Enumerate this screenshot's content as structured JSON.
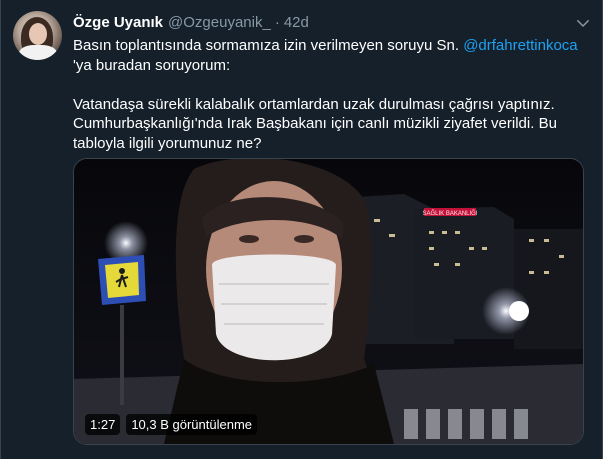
{
  "author": {
    "name": "Özge Uyanık",
    "handle": "@Ozgeuyanik_",
    "separator": "·",
    "time": "42d"
  },
  "tweet": {
    "line1_prefix": "Basın toplantısında sormamıza izin verilmeyen soruyu Sn.",
    "mention": "@drfahrettinkoca",
    "line1_suffix": "'ya buradan soruyorum:",
    "line2": "Vatandaşa sürekli kalabalık ortamlardan uzak durulması çağrısı yaptınız. Cumhurbaşkanlığı'nda Irak Başbakanı için canlı müzikli ziyafet verildi. Bu tabloyla ilgili yorumunuz ne?"
  },
  "video": {
    "duration": "1:27",
    "views": "10,3 B görüntülenme",
    "building_sign": "SAĞLIK BAKANLIĞI"
  },
  "icons": {
    "more": "chevron-down-icon",
    "avatar": "avatar"
  },
  "colors": {
    "background": "#15202b",
    "link": "#1da1f2",
    "secondary_text": "#8899a6"
  }
}
